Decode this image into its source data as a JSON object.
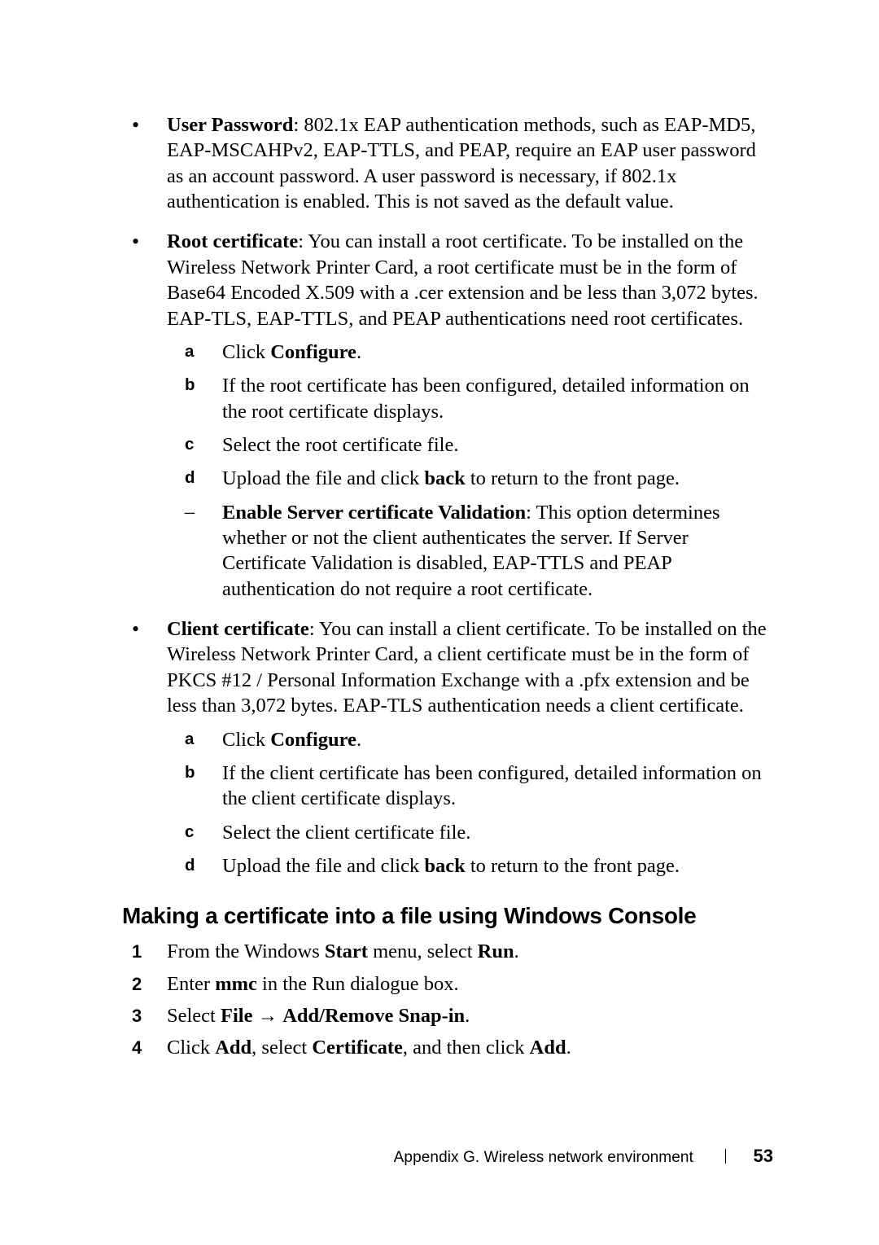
{
  "bullets": [
    {
      "label": "User Password",
      "text": ": 802.1x EAP authentication methods, such as EAP-MD5, EAP-MSCAHPv2, EAP-TTLS, and PEAP, require an EAP user password as an account password. A user password is necessary, if 802.1x authentication is enabled. This is not saved as the default value."
    },
    {
      "label": "Root certificate",
      "text": ": You can install a root certificate. To be installed on the Wireless Network Printer Card, a root certificate must be in the form of Base64 Encoded X.509 with a .cer extension and be less than 3,072 bytes. EAP-TLS, EAP-TTLS, and PEAP authentications need root certificates.",
      "steps": [
        {
          "m": "a",
          "pre": "Click ",
          "bold": "Configure",
          "post": "."
        },
        {
          "m": "b",
          "text": "If the root certificate has been configured, detailed information on the root certificate displays."
        },
        {
          "m": "c",
          "text": "Select the root certificate file."
        },
        {
          "m": "d",
          "pre": "Upload the file and click ",
          "bold": "back",
          "post": " to return to the front page."
        }
      ],
      "dash": {
        "label": "Enable Server certificate Validation",
        "text": ": This option determines whether or not the client authenticates the server. If Server Certificate Validation is disabled, EAP-TTLS and PEAP authentication do not require a root certificate."
      }
    },
    {
      "label": "Client certificate",
      "text": ": You can install a client certificate. To be installed on the Wireless Network Printer Card, a client certificate must be in the form of PKCS #12 / Personal Information Exchange with a .pfx extension and be less than 3,072 bytes. EAP-TLS authentication needs a client certificate.",
      "steps": [
        {
          "m": "a",
          "pre": "Click ",
          "bold": "Configure",
          "post": "."
        },
        {
          "m": "b",
          "text": "If the client certificate has been configured, detailed information on the client certificate displays."
        },
        {
          "m": "c",
          "text": "Select the client certificate file."
        },
        {
          "m": "d",
          "pre": "Upload the file and click ",
          "bold": "back",
          "post": " to return to the front page."
        }
      ]
    }
  ],
  "section_title": "Making a certificate into a file using Windows Console",
  "numbered": [
    {
      "n": "1",
      "parts": [
        {
          "t": "From the Windows "
        },
        {
          "b": "Start"
        },
        {
          "t": " menu, select "
        },
        {
          "b": "Run"
        },
        {
          "t": "."
        }
      ]
    },
    {
      "n": "2",
      "parts": [
        {
          "t": "Enter "
        },
        {
          "b": "mmc"
        },
        {
          "t": " in the Run dialogue box."
        }
      ]
    },
    {
      "n": "3",
      "parts": [
        {
          "t": "Select "
        },
        {
          "b": "File"
        },
        {
          "t": " "
        },
        {
          "arrow": true
        },
        {
          "t": " "
        },
        {
          "b": "Add/Remove Snap-in"
        },
        {
          "t": "."
        }
      ]
    },
    {
      "n": "4",
      "parts": [
        {
          "t": "Click "
        },
        {
          "b": "Add"
        },
        {
          "t": ", select "
        },
        {
          "b": "Certificate"
        },
        {
          "t": ", and then click "
        },
        {
          "b": "Add"
        },
        {
          "t": "."
        }
      ]
    }
  ],
  "footer": {
    "appendix": "Appendix G. Wireless network environment",
    "page": "53"
  },
  "arrow_glyph": "→"
}
